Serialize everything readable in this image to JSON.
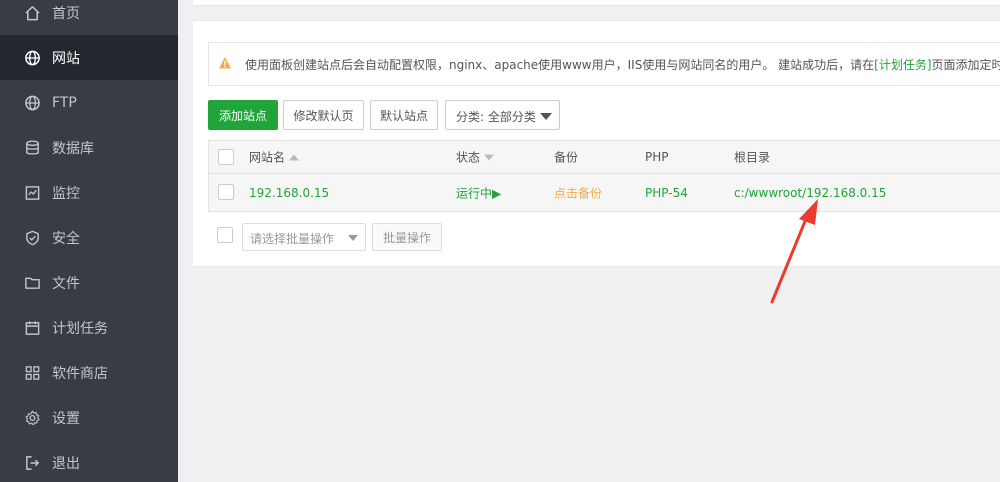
{
  "sidebar": {
    "items": [
      {
        "label": "首页",
        "icon": "home-icon"
      },
      {
        "label": "网站",
        "icon": "globe-icon",
        "active": true
      },
      {
        "label": "FTP",
        "icon": "globe-icon"
      },
      {
        "label": "数据库",
        "icon": "database-icon"
      },
      {
        "label": "监控",
        "icon": "monitor-icon"
      },
      {
        "label": "安全",
        "icon": "shield-icon"
      },
      {
        "label": "文件",
        "icon": "folder-icon"
      },
      {
        "label": "计划任务",
        "icon": "calendar-icon"
      },
      {
        "label": "软件商店",
        "icon": "apps-icon"
      },
      {
        "label": "设置",
        "icon": "gear-icon"
      },
      {
        "label": "退出",
        "icon": "logout-icon"
      }
    ]
  },
  "notice": {
    "text_before": "使用面板创建站点后会自动配置权限，nginx、apache使用www用户，IIS使用与网站同名的用户。 建站成功后，请在",
    "link": "[计划任务]",
    "text_after": "页面添加定时备份任务！"
  },
  "toolbar": {
    "add_site": "添加站点",
    "edit_default_page": "修改默认页",
    "default_site": "默认站点",
    "category_select": "分类: 全部分类"
  },
  "table": {
    "headers": {
      "name": "网站名",
      "status": "状态",
      "backup": "备份",
      "php": "PHP",
      "root": "根目录"
    },
    "rows": [
      {
        "name": "192.168.0.15",
        "status": "运行中▶",
        "backup": "点击备份",
        "php": "PHP-54",
        "root": "c:/wwwroot/192.168.0.15"
      }
    ]
  },
  "batch": {
    "placeholder": "请选择批量操作",
    "button": "批量操作"
  },
  "colors": {
    "sidebar_bg": "#383c43",
    "sidebar_active": "#23272e",
    "accent_green": "#20a53a",
    "backup_orange": "#f0ad4e",
    "annotation_red": "#ee3a2c"
  }
}
